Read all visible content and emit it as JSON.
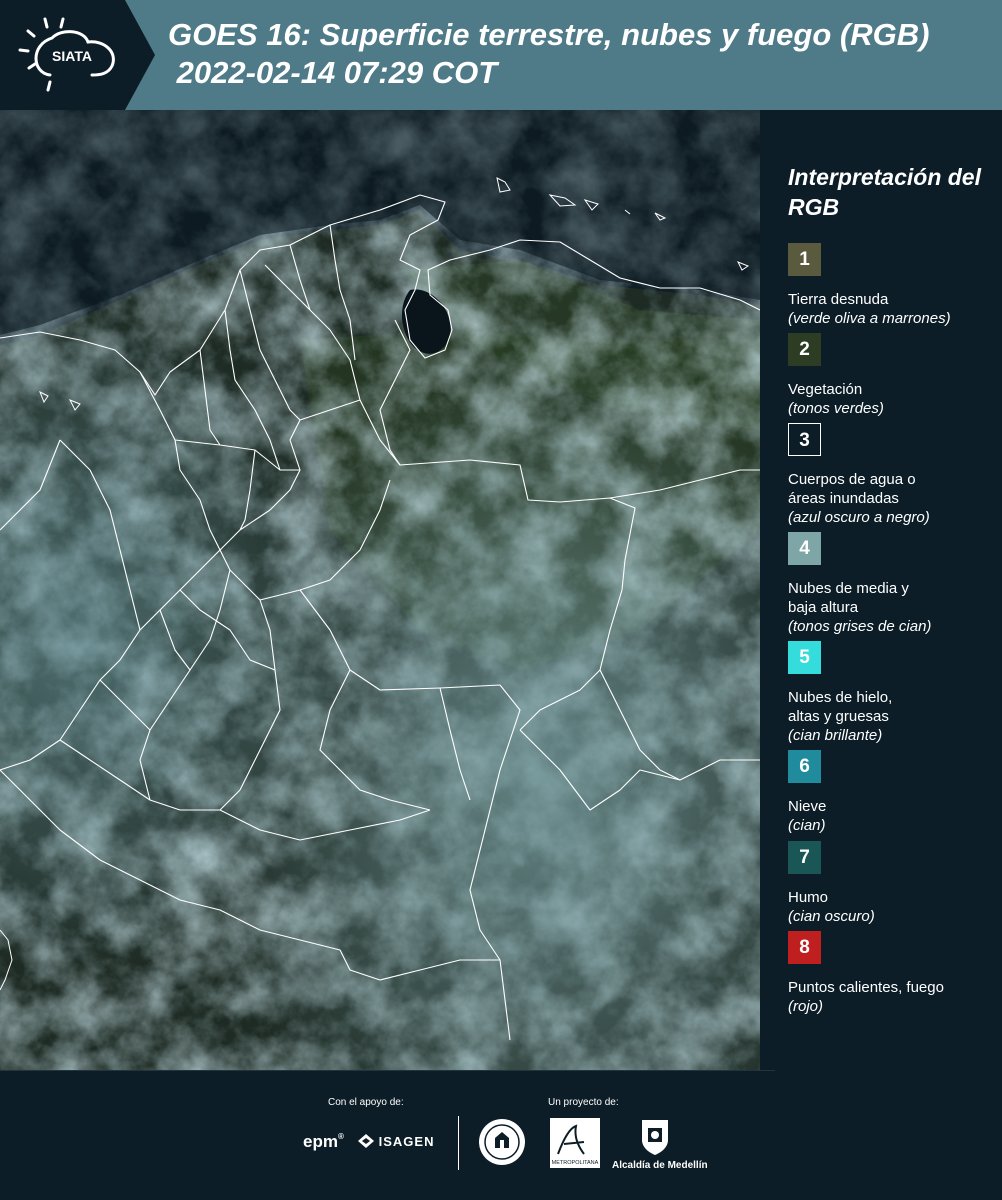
{
  "header": {
    "logo_text": "SIATA",
    "title_line1": "GOES 16: Superficie terrestre, nubes y fuego (RGB)",
    "title_line2": " 2022-02-14 07:29 COT"
  },
  "legend": {
    "title": "Interpretación del RGB",
    "items": [
      {
        "num": "1",
        "label": "Tierra desnuda",
        "sub": "(verde oliva a marrones)",
        "color": "#5a5a3f"
      },
      {
        "num": "2",
        "label": "Vegetación",
        "sub": "(tonos verdes)",
        "color": "#2c3d24"
      },
      {
        "num": "3",
        "label": "Cuerpos de agua o\náreas inundadas",
        "sub": "(azul oscuro a negro)",
        "color": "#0c1d27"
      },
      {
        "num": "4",
        "label": "Nubes de media y\nbaja altura",
        "sub": "(tonos grises de cian)",
        "color": "#7ea6a7"
      },
      {
        "num": "5",
        "label": "Nubes de hielo,\naltas y gruesas",
        "sub": "(cian brillante)",
        "color": "#35dcdc"
      },
      {
        "num": "6",
        "label": "Nieve",
        "sub": "(cian)",
        "color": "#1f8b9c"
      },
      {
        "num": "7",
        "label": "Humo",
        "sub": "(cian oscuro)",
        "color": "#1b5656"
      },
      {
        "num": "8",
        "label": "Puntos calientes, fuego",
        "sub": "(rojo)",
        "color": "#c01f1f"
      }
    ]
  },
  "footer": {
    "support_label": "Con el apoyo de:",
    "project_label": "Un proyecto de:",
    "sponsor_epm": "epm",
    "sponsor_isagen": "ISAGEN",
    "sponsor_metro": "METROPOLITANA",
    "sponsor_alcaldia": "Alcaldía de Medellín"
  }
}
